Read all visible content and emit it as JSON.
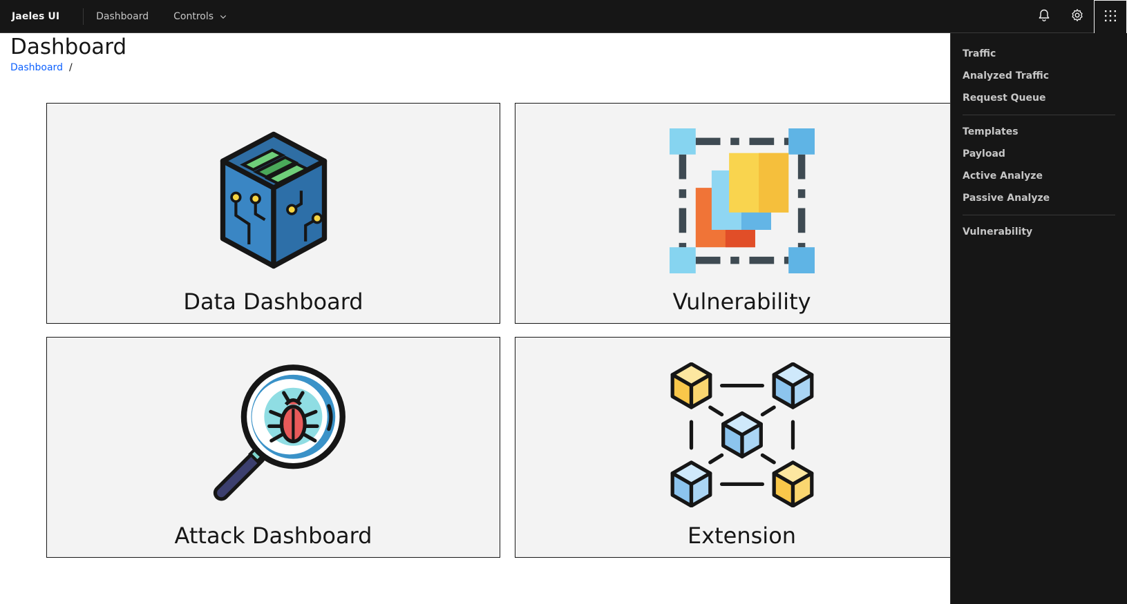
{
  "header": {
    "brand": "Jaeles UI",
    "nav": [
      {
        "label": "Dashboard"
      },
      {
        "label": "Controls"
      }
    ],
    "actions": [
      "notification-icon",
      "settings-icon",
      "app-switcher-icon"
    ]
  },
  "page": {
    "title": "Dashboard",
    "breadcrumb": [
      {
        "label": "Dashboard"
      }
    ],
    "breadcrumb_separator": "/"
  },
  "tiles": [
    {
      "label": "Data Dashboard",
      "icon": "data-cube-icon"
    },
    {
      "label": "Vulnerability",
      "icon": "vulnerability-layers-icon"
    },
    {
      "label": "Attack Dashboard",
      "icon": "bug-magnifier-icon"
    },
    {
      "label": "Extension",
      "icon": "extension-network-icon"
    }
  ],
  "panel": {
    "groups": [
      [
        "Traffic",
        "Analyzed Traffic",
        "Request Queue"
      ],
      [
        "Templates",
        "Payload",
        "Active Analyze",
        "Passive Analyze"
      ],
      [
        "Vulnerability"
      ]
    ]
  },
  "colors": {
    "header_bg": "#161616",
    "link": "#0f62fe",
    "tile_bg": "#f3f3f3",
    "panel_bg": "#161616"
  }
}
